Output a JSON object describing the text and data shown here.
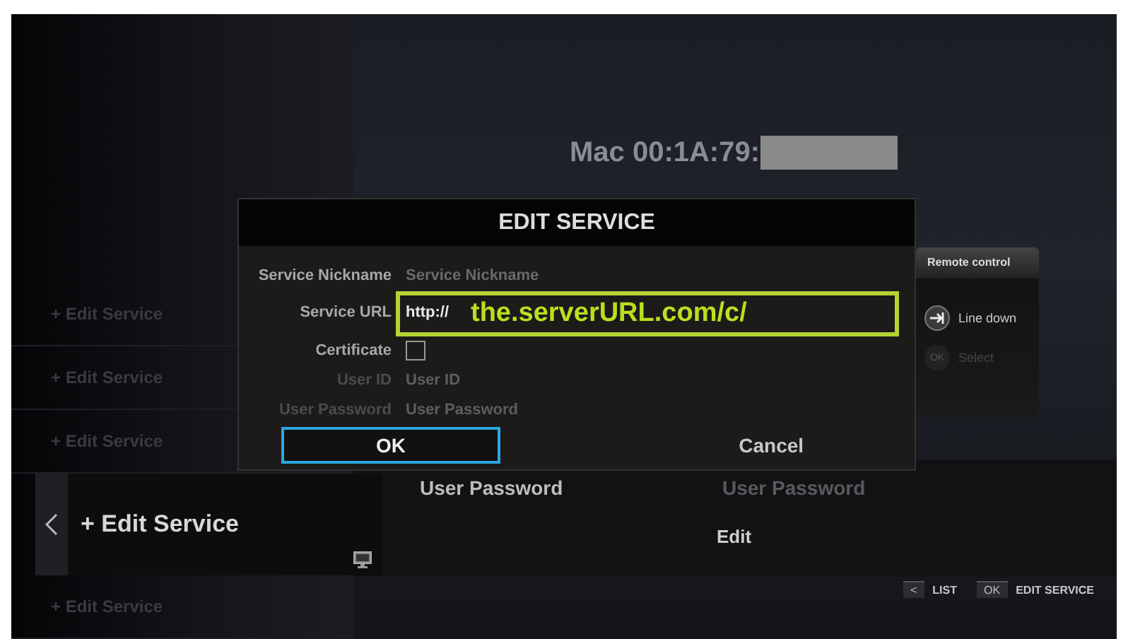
{
  "mac_label": "Mac 00:1A:79:",
  "services": [
    {
      "label": "+ Edit Service",
      "selected": false
    },
    {
      "label": "+ Edit Service",
      "selected": false
    },
    {
      "label": "+ Edit Service",
      "selected": false
    },
    {
      "label": "+ Edit Service",
      "selected": true
    },
    {
      "label": "+ Edit Service",
      "selected": false
    }
  ],
  "details": {
    "label": "User Password",
    "value": "User Password",
    "action": "Edit"
  },
  "footer_hints": [
    {
      "key": "<",
      "label": "LIST"
    },
    {
      "key": "OK",
      "label": "EDIT SERVICE"
    }
  ],
  "dialog": {
    "title": "EDIT SERVICE",
    "fields": [
      {
        "kind": "text",
        "label": "Service Nickname",
        "placeholder": "Service Nickname",
        "disabled": false
      },
      {
        "kind": "text",
        "label": "Service URL",
        "value": "http://",
        "disabled": false
      },
      {
        "kind": "checkbox",
        "label": "Certificate",
        "checked": false,
        "disabled": false
      },
      {
        "kind": "text",
        "label": "User ID",
        "placeholder": "User ID",
        "disabled": true
      },
      {
        "kind": "text",
        "label": "User Password",
        "placeholder": "User Password",
        "disabled": true
      }
    ],
    "buttons": [
      {
        "label": "OK",
        "selected": true
      },
      {
        "label": "Cancel",
        "selected": false
      }
    ]
  },
  "annotation": {
    "text": "the.serverURL.com/c/"
  },
  "remote_panel": {
    "title": "Remote control",
    "items": [
      {
        "kind": "line-down",
        "label": "Line down",
        "disabled": false
      },
      {
        "kind": "key",
        "key": "OK",
        "label": "Select",
        "disabled": true
      }
    ]
  }
}
